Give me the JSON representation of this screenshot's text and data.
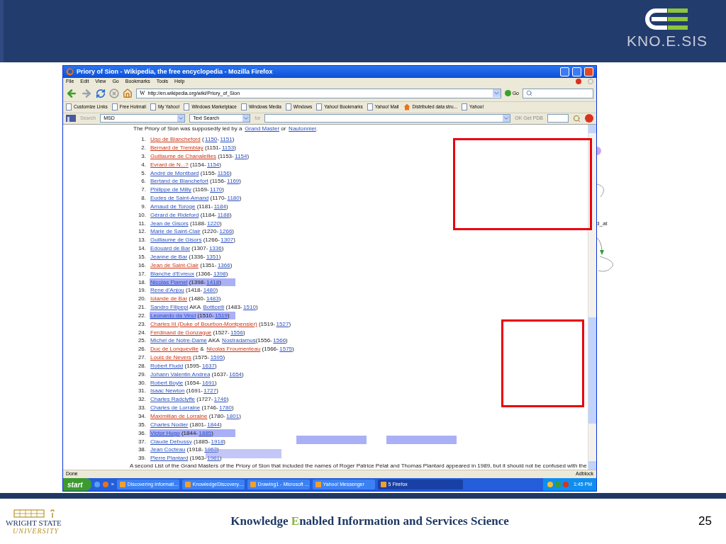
{
  "slide": {
    "header": {
      "logo_text": "KNO.E.SIS"
    },
    "footer": {
      "university": [
        "WRIGHT STATE",
        "UNIVERSITY"
      ],
      "title": [
        {
          "text": "Knowledge ",
          "accent": false
        },
        {
          "text": "E",
          "accent": true
        },
        {
          "text": "nabled Information and Services Science",
          "accent": false
        }
      ],
      "page_number": "25"
    }
  },
  "diagram": {
    "label": "d_at"
  },
  "browser": {
    "title": "Priory of Sion - Wikipedia, the free encyclopedia - Mozilla Firefox",
    "menu": [
      "File",
      "Edit",
      "View",
      "Go",
      "Bookmarks",
      "Tools",
      "Help"
    ],
    "site_icon": "W",
    "url": "http://en.wikipedia.org/wiki/Priory_of_Sion",
    "go": "Go",
    "bookmarks": [
      {
        "label": "Customize Links",
        "kind": "page"
      },
      {
        "label": "Free Hotmail",
        "kind": "page"
      },
      {
        "label": "My Yahoo!",
        "kind": "page"
      },
      {
        "label": "Windows Marketplace",
        "kind": "page"
      },
      {
        "label": "Windows Media",
        "kind": "page"
      },
      {
        "label": "Windows",
        "kind": "page"
      },
      {
        "label": "Yahoo! Bookmarks",
        "kind": "page"
      },
      {
        "label": "Yahoo! Mail",
        "kind": "page"
      },
      {
        "label": "Distributed data stru...",
        "kind": "home"
      },
      {
        "label": "Yahoo!",
        "kind": "page"
      }
    ],
    "search_toolbar": {
      "search": "Search",
      "engine": "MSD",
      "mode": "Text Search",
      "for": "for",
      "pdb": "OK Get PDB"
    },
    "content": {
      "intro": [
        {
          "text": "The Priory of Sion was supposedly led by a ",
          "kind": "plain"
        },
        {
          "text": "Grand Master",
          "kind": "link"
        },
        {
          "text": " or ",
          "kind": "plain"
        },
        {
          "text": "Nautonnier",
          "kind": "link"
        },
        {
          "text": ".",
          "kind": "plain"
        }
      ],
      "items": [
        {
          "number": "1.",
          "highlighted": false,
          "parts": [
            {
              "text": "Ugo de Blancheford",
              "kind": "missing"
            },
            {
              "text": " (",
              "kind": "plain"
            },
            {
              "text": "1150",
              "kind": "link"
            },
            {
              "text": "-",
              "kind": "plain"
            },
            {
              "text": "1151",
              "kind": "link"
            },
            {
              "text": ")",
              "kind": "plain"
            }
          ]
        },
        {
          "number": "2.",
          "highlighted": false,
          "parts": [
            {
              "text": "Bernard de Tremblay",
              "kind": "missing"
            },
            {
              "text": " (1151-",
              "kind": "plain"
            },
            {
              "text": "1153",
              "kind": "link"
            },
            {
              "text": ")",
              "kind": "plain"
            }
          ]
        },
        {
          "number": "3.",
          "highlighted": false,
          "parts": [
            {
              "text": "Guillaume de Chanaleilles",
              "kind": "missing"
            },
            {
              "text": " (1153-",
              "kind": "plain"
            },
            {
              "text": "1154",
              "kind": "link"
            },
            {
              "text": ")",
              "kind": "plain"
            }
          ]
        },
        {
          "number": "4.",
          "highlighted": false,
          "parts": [
            {
              "text": "Evrard de N...?",
              "kind": "missing"
            },
            {
              "text": " (1154-",
              "kind": "plain"
            },
            {
              "text": "1154",
              "kind": "link"
            },
            {
              "text": ")",
              "kind": "plain"
            }
          ]
        },
        {
          "number": "5.",
          "highlighted": false,
          "parts": [
            {
              "text": "André de Montbard",
              "kind": "link"
            },
            {
              "text": " (1155-",
              "kind": "plain"
            },
            {
              "text": "1156",
              "kind": "link"
            },
            {
              "text": ")",
              "kind": "plain"
            }
          ]
        },
        {
          "number": "6.",
          "highlighted": false,
          "parts": [
            {
              "text": "Bertand de Blanchefort",
              "kind": "link"
            },
            {
              "text": " (1156-",
              "kind": "plain"
            },
            {
              "text": "1169",
              "kind": "link"
            },
            {
              "text": ")",
              "kind": "plain"
            }
          ]
        },
        {
          "number": "7.",
          "highlighted": false,
          "parts": [
            {
              "text": "Philippe de Milly",
              "kind": "link"
            },
            {
              "text": " (1169-",
              "kind": "plain"
            },
            {
              "text": "1170",
              "kind": "link"
            },
            {
              "text": ")",
              "kind": "plain"
            }
          ]
        },
        {
          "number": "8.",
          "highlighted": false,
          "parts": [
            {
              "text": "Eudes de Saint-Amand",
              "kind": "link"
            },
            {
              "text": " (1170-",
              "kind": "plain"
            },
            {
              "text": "1180",
              "kind": "link"
            },
            {
              "text": ")",
              "kind": "plain"
            }
          ]
        },
        {
          "number": "9.",
          "highlighted": false,
          "parts": [
            {
              "text": "Arnaud de Toroge",
              "kind": "link"
            },
            {
              "text": " (1181-",
              "kind": "plain"
            },
            {
              "text": "1184",
              "kind": "link"
            },
            {
              "text": ")",
              "kind": "plain"
            }
          ]
        },
        {
          "number": "10.",
          "highlighted": false,
          "parts": [
            {
              "text": "Gérard de Rideford",
              "kind": "link"
            },
            {
              "text": " (1184-",
              "kind": "plain"
            },
            {
              "text": "1188",
              "kind": "link"
            },
            {
              "text": ")",
              "kind": "plain"
            }
          ]
        },
        {
          "number": "11.",
          "highlighted": false,
          "parts": [
            {
              "text": "Jean de Gisors",
              "kind": "link"
            },
            {
              "text": " (1188-",
              "kind": "plain"
            },
            {
              "text": "1220",
              "kind": "link"
            },
            {
              "text": ")",
              "kind": "plain"
            }
          ]
        },
        {
          "number": "12.",
          "highlighted": false,
          "parts": [
            {
              "text": "Marie de Saint-Clair",
              "kind": "link"
            },
            {
              "text": " (1220-",
              "kind": "plain"
            },
            {
              "text": "1266",
              "kind": "link"
            },
            {
              "text": ")",
              "kind": "plain"
            }
          ]
        },
        {
          "number": "13.",
          "highlighted": false,
          "parts": [
            {
              "text": "Guillaume de Gisors",
              "kind": "link"
            },
            {
              "text": " (1266-",
              "kind": "plain"
            },
            {
              "text": "1307",
              "kind": "link"
            },
            {
              "text": ")",
              "kind": "plain"
            }
          ]
        },
        {
          "number": "14.",
          "highlighted": false,
          "parts": [
            {
              "text": "Edouard de Bar",
              "kind": "link"
            },
            {
              "text": " (1307-",
              "kind": "plain"
            },
            {
              "text": "1336",
              "kind": "link"
            },
            {
              "text": ")",
              "kind": "plain"
            }
          ]
        },
        {
          "number": "15.",
          "highlighted": false,
          "parts": [
            {
              "text": "Jeanne de Bar",
              "kind": "link"
            },
            {
              "text": " (1336-",
              "kind": "plain"
            },
            {
              "text": "1351",
              "kind": "link"
            },
            {
              "text": ")",
              "kind": "plain"
            }
          ]
        },
        {
          "number": "16.",
          "highlighted": false,
          "parts": [
            {
              "text": "Jean de Saint-Clair",
              "kind": "missing"
            },
            {
              "text": " (1351-",
              "kind": "plain"
            },
            {
              "text": "1366",
              "kind": "link"
            },
            {
              "text": ")",
              "kind": "plain"
            }
          ]
        },
        {
          "number": "17.",
          "highlighted": false,
          "parts": [
            {
              "text": "Blanche d'Evreux",
              "kind": "link"
            },
            {
              "text": " (1366-",
              "kind": "plain"
            },
            {
              "text": "1398",
              "kind": "link"
            },
            {
              "text": ")",
              "kind": "plain"
            }
          ]
        },
        {
          "number": "18.",
          "highlighted": true,
          "parts": [
            {
              "text": "Nicolas Flamel",
              "kind": "link"
            },
            {
              "text": " (1398-",
              "kind": "plain"
            },
            {
              "text": "1418",
              "kind": "link"
            },
            {
              "text": ")",
              "kind": "plain"
            }
          ]
        },
        {
          "number": "19.",
          "highlighted": false,
          "parts": [
            {
              "text": "Rene d'Anjou",
              "kind": "link"
            },
            {
              "text": " (1418-",
              "kind": "plain"
            },
            {
              "text": "1480",
              "kind": "link"
            },
            {
              "text": ")",
              "kind": "plain"
            }
          ]
        },
        {
          "number": "20.",
          "highlighted": false,
          "parts": [
            {
              "text": "Iolande de Bar",
              "kind": "missing"
            },
            {
              "text": " (1480-",
              "kind": "plain"
            },
            {
              "text": "1483",
              "kind": "link"
            },
            {
              "text": ")",
              "kind": "plain"
            }
          ]
        },
        {
          "number": "21.",
          "highlighted": false,
          "parts": [
            {
              "text": "Sandro Filipepi",
              "kind": "link"
            },
            {
              "text": " AKA ",
              "kind": "plain"
            },
            {
              "text": "Botticelli",
              "kind": "link"
            },
            {
              "text": " (1483-",
              "kind": "plain"
            },
            {
              "text": "1510",
              "kind": "link"
            },
            {
              "text": ")",
              "kind": "plain"
            }
          ]
        },
        {
          "number": "22.",
          "highlighted": true,
          "parts": [
            {
              "text": "Leonardo da Vinci",
              "kind": "link"
            },
            {
              "text": " (1510-",
              "kind": "plain"
            },
            {
              "text": "1519",
              "kind": "link"
            },
            {
              "text": ")",
              "kind": "plain"
            }
          ]
        },
        {
          "number": "23.",
          "highlighted": false,
          "parts": [
            {
              "text": "Charles III (Duke of Bourbon-Montpensier)",
              "kind": "missing"
            },
            {
              "text": " (1519-",
              "kind": "plain"
            },
            {
              "text": "1527",
              "kind": "link"
            },
            {
              "text": ")",
              "kind": "plain"
            }
          ]
        },
        {
          "number": "24.",
          "highlighted": false,
          "parts": [
            {
              "text": "Ferdinand de Gonzague",
              "kind": "missing"
            },
            {
              "text": " (1527-",
              "kind": "plain"
            },
            {
              "text": "1556",
              "kind": "link"
            },
            {
              "text": ")",
              "kind": "plain"
            }
          ]
        },
        {
          "number": "25.",
          "highlighted": false,
          "parts": [
            {
              "text": "Michel de Notre-Dame",
              "kind": "link"
            },
            {
              "text": " AKA ",
              "kind": "plain"
            },
            {
              "text": "Nostradamus",
              "kind": "link"
            },
            {
              "text": "(1556-",
              "kind": "plain"
            },
            {
              "text": "1566",
              "kind": "link"
            },
            {
              "text": ")",
              "kind": "plain"
            }
          ]
        },
        {
          "number": "26.",
          "highlighted": false,
          "parts": [
            {
              "text": "Duc de Longueville",
              "kind": "missing"
            },
            {
              "text": " & ",
              "kind": "plain"
            },
            {
              "text": "Nicolas Froumenteau",
              "kind": "missing"
            },
            {
              "text": " (1566-",
              "kind": "plain"
            },
            {
              "text": "1575",
              "kind": "link"
            },
            {
              "text": ")",
              "kind": "plain"
            }
          ]
        },
        {
          "number": "27.",
          "highlighted": false,
          "parts": [
            {
              "text": "Louis de Nevers",
              "kind": "missing"
            },
            {
              "text": " (1575-",
              "kind": "plain"
            },
            {
              "text": "1595",
              "kind": "link"
            },
            {
              "text": ")",
              "kind": "plain"
            }
          ]
        },
        {
          "number": "28.",
          "highlighted": false,
          "parts": [
            {
              "text": "Robert Fludd",
              "kind": "link"
            },
            {
              "text": " (1595-",
              "kind": "plain"
            },
            {
              "text": "1637",
              "kind": "link"
            },
            {
              "text": ")",
              "kind": "plain"
            }
          ]
        },
        {
          "number": "29.",
          "highlighted": false,
          "parts": [
            {
              "text": "Johann Valentin Andrea",
              "kind": "link"
            },
            {
              "text": " (1637-",
              "kind": "plain"
            },
            {
              "text": "1654",
              "kind": "link"
            },
            {
              "text": ")",
              "kind": "plain"
            }
          ]
        },
        {
          "number": "30.",
          "highlighted": false,
          "parts": [
            {
              "text": "Robert Boyle",
              "kind": "link"
            },
            {
              "text": " (1654-",
              "kind": "plain"
            },
            {
              "text": "1691",
              "kind": "link"
            },
            {
              "text": ")",
              "kind": "plain"
            }
          ]
        },
        {
          "number": "31.",
          "highlighted": false,
          "parts": [
            {
              "text": "Isaac Newton",
              "kind": "link"
            },
            {
              "text": " (1691-",
              "kind": "plain"
            },
            {
              "text": "1727",
              "kind": "link"
            },
            {
              "text": ")",
              "kind": "plain"
            }
          ]
        },
        {
          "number": "32.",
          "highlighted": false,
          "parts": [
            {
              "text": "Charles Radclyffe",
              "kind": "link"
            },
            {
              "text": " (1727-",
              "kind": "plain"
            },
            {
              "text": "1746",
              "kind": "link"
            },
            {
              "text": ")",
              "kind": "plain"
            }
          ]
        },
        {
          "number": "33.",
          "highlighted": false,
          "parts": [
            {
              "text": "Charles de Lorraine",
              "kind": "link"
            },
            {
              "text": " (1746-",
              "kind": "plain"
            },
            {
              "text": "1780",
              "kind": "link"
            },
            {
              "text": ")",
              "kind": "plain"
            }
          ]
        },
        {
          "number": "34.",
          "highlighted": false,
          "parts": [
            {
              "text": "Maximilian de Lorraine",
              "kind": "missing"
            },
            {
              "text": " (1780-",
              "kind": "plain"
            },
            {
              "text": "1801",
              "kind": "link"
            },
            {
              "text": ")",
              "kind": "plain"
            }
          ]
        },
        {
          "number": "35.",
          "highlighted": false,
          "parts": [
            {
              "text": "Charles Nodier",
              "kind": "link"
            },
            {
              "text": " (1801-",
              "kind": "plain"
            },
            {
              "text": "1844",
              "kind": "link"
            },
            {
              "text": ")",
              "kind": "plain"
            }
          ]
        },
        {
          "number": "36.",
          "highlighted": true,
          "parts": [
            {
              "text": "Victor Hugo",
              "kind": "link"
            },
            {
              "text": " (1844-",
              "kind": "plain"
            },
            {
              "text": "1885",
              "kind": "link"
            },
            {
              "text": ")",
              "kind": "plain"
            }
          ]
        },
        {
          "number": "37.",
          "highlighted": false,
          "parts": [
            {
              "text": "Claude Debussy",
              "kind": "link"
            },
            {
              "text": " (1885-",
              "kind": "plain"
            },
            {
              "text": "1918",
              "kind": "link"
            },
            {
              "text": ")",
              "kind": "plain"
            }
          ]
        },
        {
          "number": "38.",
          "highlighted": false,
          "parts": [
            {
              "text": "Jean Cocteau",
              "kind": "link"
            },
            {
              "text": " (1918-",
              "kind": "plain"
            },
            {
              "text": "1963",
              "kind": "link"
            },
            {
              "text": ")",
              "kind": "plain"
            }
          ]
        },
        {
          "number": "39.",
          "highlighted": false,
          "parts": [
            {
              "text": "Pierre Plantard",
              "kind": "link"
            },
            {
              "text": " (1963-",
              "kind": "plain"
            },
            {
              "text": "1981",
              "kind": "link"
            },
            {
              "text": ")",
              "kind": "plain"
            }
          ]
        }
      ],
      "closing": "A second List of the Grand Masters of the Priory of Sion that included the names of Roger Patrice Pelat and Thomas Plantard appeared in 1989, but it should not be confused with the"
    },
    "status": {
      "text": "Done",
      "addon": "Adblock"
    },
    "taskbar": {
      "start": "start",
      "more": "»",
      "tasks": [
        {
          "label": "Discovering Informati...",
          "selected": false
        },
        {
          "label": "KnowledgeDiscovery....",
          "selected": false
        },
        {
          "label": "Drawing1 - Microsoft ...",
          "selected": false
        },
        {
          "label": "Yahoo! Messenger",
          "selected": false
        },
        {
          "label": "5 Firefox",
          "selected": true
        }
      ],
      "clock": "1:45 PM"
    }
  }
}
